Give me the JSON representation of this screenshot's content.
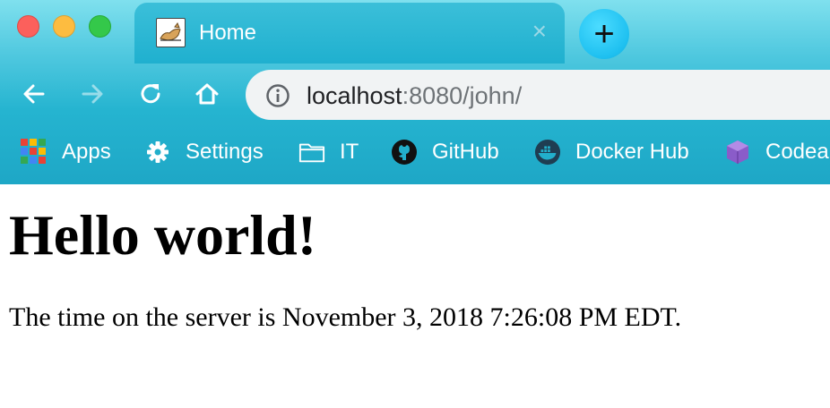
{
  "window": {
    "traffic_lights": [
      "close",
      "minimize",
      "maximize"
    ]
  },
  "tab": {
    "title": "Home",
    "close_glyph": "×",
    "favicon": "tomcat-icon"
  },
  "new_tab": {
    "glyph": "+"
  },
  "toolbar": {
    "icons": [
      "back-arrow-icon",
      "forward-arrow-icon",
      "reload-icon",
      "home-icon"
    ]
  },
  "address_bar": {
    "host": "localhost",
    "rest": ":8080/john/",
    "icon": "info-icon"
  },
  "bookmarks": [
    {
      "label": "Apps",
      "icon": "apps-grid-icon"
    },
    {
      "label": "Settings",
      "icon": "gear-icon"
    },
    {
      "label": "IT",
      "icon": "folder-icon"
    },
    {
      "label": "GitHub",
      "icon": "github-icon"
    },
    {
      "label": "Docker Hub",
      "icon": "docker-icon"
    },
    {
      "label": "Codea",
      "icon": "codeanywhere-icon"
    }
  ],
  "page": {
    "heading": "Hello world!",
    "text": "The time on the server is November 3, 2018 7:26:08 PM EDT."
  },
  "colors": {
    "chrome_accent": "#1ea7c6",
    "traffic_close": "#fc605c",
    "traffic_min": "#fdbc40",
    "traffic_max": "#34c84a"
  }
}
